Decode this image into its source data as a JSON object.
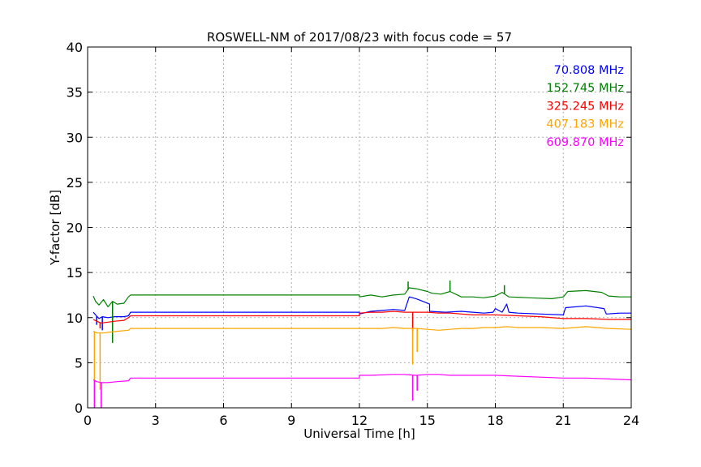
{
  "chart_data": {
    "type": "line",
    "title": "ROSWELL-NM of 2017/08/23 with focus code = 57",
    "xlabel": "Universal Time [h]",
    "ylabel": "Y-factor [dB]",
    "xlim": [
      0,
      24
    ],
    "ylim": [
      0,
      40
    ],
    "x_ticks": [
      0,
      3,
      6,
      9,
      12,
      15,
      18,
      21,
      24
    ],
    "y_ticks": [
      0,
      5,
      10,
      15,
      20,
      25,
      30,
      35,
      40
    ],
    "grid": true,
    "legend_position": "top-right",
    "series": [
      {
        "name": "70.808 MHz",
        "color": "#0000ff",
        "points": [
          [
            0.25,
            10.6
          ],
          [
            0.35,
            10.3
          ],
          [
            0.5,
            9.9
          ],
          [
            0.65,
            10.1
          ],
          [
            0.9,
            10.0
          ],
          [
            1.2,
            10.1
          ],
          [
            1.6,
            10.1
          ],
          [
            1.8,
            10.2
          ],
          [
            1.9,
            10.6
          ],
          [
            12.0,
            10.6
          ],
          [
            12.0,
            10.4
          ],
          [
            12.5,
            10.7
          ],
          [
            13.0,
            10.8
          ],
          [
            13.5,
            10.9
          ],
          [
            14.0,
            10.8
          ],
          [
            14.2,
            12.3
          ],
          [
            14.5,
            12.1
          ],
          [
            14.8,
            11.8
          ],
          [
            15.1,
            11.5
          ],
          [
            15.1,
            10.7
          ],
          [
            15.8,
            10.6
          ],
          [
            16.5,
            10.7
          ],
          [
            17.0,
            10.6
          ],
          [
            17.5,
            10.5
          ],
          [
            17.9,
            10.6
          ],
          [
            18.0,
            11.0
          ],
          [
            18.3,
            10.6
          ],
          [
            18.5,
            11.5
          ],
          [
            18.6,
            10.6
          ],
          [
            19.0,
            10.5
          ],
          [
            20.0,
            10.4
          ],
          [
            21.0,
            10.3
          ],
          [
            21.1,
            11.1
          ],
          [
            22.0,
            11.3
          ],
          [
            22.8,
            11.0
          ],
          [
            22.9,
            10.4
          ],
          [
            23.5,
            10.5
          ],
          [
            24.0,
            10.5
          ]
        ],
        "spikes": [
          [
            0.4,
            9.2
          ],
          [
            0.65,
            8.6
          ],
          [
            1.1,
            9.2
          ]
        ]
      },
      {
        "name": "152.745 MHz",
        "color": "#008000",
        "points": [
          [
            0.25,
            12.4
          ],
          [
            0.35,
            11.8
          ],
          [
            0.5,
            11.4
          ],
          [
            0.7,
            12.0
          ],
          [
            0.9,
            11.2
          ],
          [
            1.1,
            11.8
          ],
          [
            1.3,
            11.5
          ],
          [
            1.6,
            11.6
          ],
          [
            1.8,
            12.3
          ],
          [
            1.9,
            12.5
          ],
          [
            12.0,
            12.5
          ],
          [
            12.0,
            12.3
          ],
          [
            12.5,
            12.5
          ],
          [
            13.0,
            12.3
          ],
          [
            13.5,
            12.5
          ],
          [
            14.0,
            12.6
          ],
          [
            14.2,
            13.3
          ],
          [
            14.5,
            13.2
          ],
          [
            15.0,
            12.9
          ],
          [
            15.2,
            12.7
          ],
          [
            15.6,
            12.6
          ],
          [
            16.0,
            12.9
          ],
          [
            16.5,
            12.3
          ],
          [
            17.0,
            12.3
          ],
          [
            17.5,
            12.2
          ],
          [
            18.0,
            12.4
          ],
          [
            18.3,
            12.8
          ],
          [
            18.6,
            12.3
          ],
          [
            19.5,
            12.2
          ],
          [
            20.5,
            12.1
          ],
          [
            21.0,
            12.3
          ],
          [
            21.2,
            12.9
          ],
          [
            22.0,
            13.0
          ],
          [
            22.7,
            12.8
          ],
          [
            23.0,
            12.4
          ],
          [
            23.5,
            12.3
          ],
          [
            24.0,
            12.3
          ]
        ],
        "spikes": [
          [
            1.1,
            7.2
          ],
          [
            14.15,
            14.0
          ],
          [
            16.0,
            14.1
          ],
          [
            18.4,
            13.6
          ]
        ]
      },
      {
        "name": "325.245 MHz",
        "color": "#ff0000",
        "points": [
          [
            0.25,
            9.8
          ],
          [
            0.4,
            9.6
          ],
          [
            0.6,
            9.4
          ],
          [
            0.9,
            9.5
          ],
          [
            1.2,
            9.6
          ],
          [
            1.6,
            9.7
          ],
          [
            1.8,
            10.0
          ],
          [
            1.9,
            10.2
          ],
          [
            12.0,
            10.2
          ],
          [
            12.0,
            10.5
          ],
          [
            12.5,
            10.6
          ],
          [
            13.0,
            10.6
          ],
          [
            13.5,
            10.7
          ],
          [
            14.0,
            10.6
          ],
          [
            14.5,
            10.6
          ],
          [
            15.0,
            10.6
          ],
          [
            15.5,
            10.5
          ],
          [
            16.0,
            10.5
          ],
          [
            17.0,
            10.3
          ],
          [
            18.0,
            10.3
          ],
          [
            19.0,
            10.2
          ],
          [
            20.0,
            10.1
          ],
          [
            21.0,
            9.9
          ],
          [
            22.0,
            9.9
          ],
          [
            23.0,
            9.8
          ],
          [
            24.0,
            9.8
          ]
        ],
        "spikes": [
          [
            0.55,
            8.8
          ],
          [
            14.35,
            8.5
          ]
        ]
      },
      {
        "name": "407.183 MHz",
        "color": "#ffa500",
        "points": [
          [
            0.25,
            8.5
          ],
          [
            0.4,
            8.3
          ],
          [
            0.7,
            8.3
          ],
          [
            1.0,
            8.4
          ],
          [
            1.4,
            8.5
          ],
          [
            1.8,
            8.6
          ],
          [
            1.9,
            8.8
          ],
          [
            12.0,
            8.8
          ],
          [
            12.5,
            8.8
          ],
          [
            13.0,
            8.8
          ],
          [
            13.5,
            8.9
          ],
          [
            14.0,
            8.8
          ],
          [
            14.5,
            8.8
          ],
          [
            15.0,
            8.7
          ],
          [
            15.5,
            8.6
          ],
          [
            16.0,
            8.7
          ],
          [
            16.5,
            8.8
          ],
          [
            17.0,
            8.8
          ],
          [
            17.5,
            8.9
          ],
          [
            18.0,
            8.9
          ],
          [
            18.5,
            9.0
          ],
          [
            19.0,
            8.9
          ],
          [
            20.0,
            8.9
          ],
          [
            21.0,
            8.8
          ],
          [
            22.0,
            9.0
          ],
          [
            23.0,
            8.8
          ],
          [
            24.0,
            8.7
          ]
        ],
        "spikes": [
          [
            0.3,
            3.0
          ],
          [
            0.55,
            2.0
          ],
          [
            14.35,
            4.8
          ],
          [
            14.55,
            6.2
          ]
        ]
      },
      {
        "name": "609.870 MHz",
        "color": "#ff00ff",
        "points": [
          [
            0.25,
            3.1
          ],
          [
            0.4,
            2.9
          ],
          [
            0.6,
            2.8
          ],
          [
            0.9,
            2.8
          ],
          [
            1.3,
            2.9
          ],
          [
            1.8,
            3.0
          ],
          [
            1.9,
            3.3
          ],
          [
            12.0,
            3.3
          ],
          [
            12.0,
            3.6
          ],
          [
            12.5,
            3.6
          ],
          [
            13.5,
            3.7
          ],
          [
            14.0,
            3.7
          ],
          [
            14.5,
            3.6
          ],
          [
            15.0,
            3.7
          ],
          [
            15.5,
            3.7
          ],
          [
            16.0,
            3.6
          ],
          [
            17.0,
            3.6
          ],
          [
            18.0,
            3.6
          ],
          [
            19.0,
            3.5
          ],
          [
            20.0,
            3.4
          ],
          [
            21.0,
            3.3
          ],
          [
            22.0,
            3.3
          ],
          [
            23.0,
            3.2
          ],
          [
            24.0,
            3.1
          ]
        ],
        "spikes": [
          [
            0.3,
            0.0
          ],
          [
            0.6,
            0.0
          ],
          [
            14.35,
            0.8
          ],
          [
            14.55,
            1.9
          ]
        ]
      }
    ]
  }
}
